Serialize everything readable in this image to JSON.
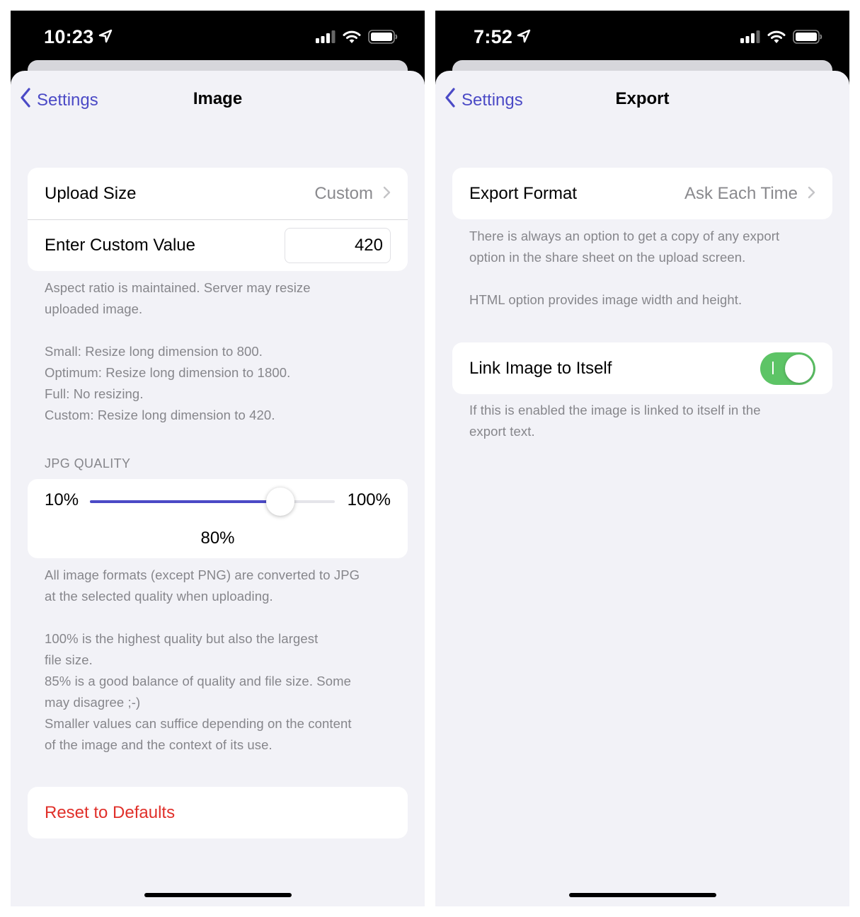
{
  "colors": {
    "accent": "#4b4ac6",
    "destructive": "#e0302a",
    "toggle_on": "#5dc466",
    "grouped_background": "#f2f2f7",
    "secondary_text": "#86868b"
  },
  "left": {
    "status": {
      "time": "10:23"
    },
    "nav": {
      "back_label": "Settings",
      "title": "Image"
    },
    "upload": {
      "size_label": "Upload Size",
      "size_value": "Custom",
      "custom_label": "Enter Custom Value",
      "custom_value": "420"
    },
    "upload_footer": [
      "Aspect ratio is maintained. Server may resize",
      "uploaded image.",
      "",
      "Small: Resize long dimension to 800.",
      "Optimum: Resize long dimension to 1800.",
      "Full: No resizing.",
      "Custom: Resize long dimension to 420."
    ],
    "jpg": {
      "header": "JPG QUALITY",
      "min_label": "10%",
      "max_label": "100%",
      "value_label": "80%",
      "min": 10,
      "max": 100,
      "value": 80
    },
    "jpg_footer": [
      "All image formats (except PNG) are converted to JPG",
      "at the selected quality when uploading.",
      "",
      "100% is the highest quality but also the largest",
      "file size.",
      "85% is a good balance of quality and file size. Some",
      "may disagree ;-)",
      "Smaller values can suffice depending on the content",
      "of the image and the context of its use."
    ],
    "reset_label": "Reset to Defaults"
  },
  "right": {
    "status": {
      "time": "7:52"
    },
    "nav": {
      "back_label": "Settings",
      "title": "Export"
    },
    "export": {
      "format_label": "Export Format",
      "format_value": "Ask Each Time"
    },
    "export_footer": [
      "There is always an option to get a copy of any export",
      "option in the share sheet on the upload screen.",
      "",
      "HTML option provides image width and height."
    ],
    "link": {
      "label": "Link Image to Itself",
      "enabled": true
    },
    "link_footer": [
      "If this is enabled the image is linked to itself in the",
      "export text."
    ]
  },
  "icons": {
    "location": "location-arrow-icon",
    "signal": "cellular-signal-icon",
    "wifi": "wifi-icon",
    "battery": "battery-icon",
    "back": "chevron-left-icon",
    "disclosure": "chevron-right-icon"
  }
}
